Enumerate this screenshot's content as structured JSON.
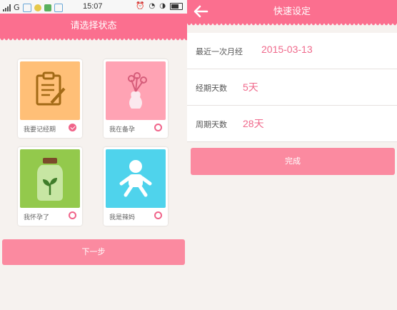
{
  "status": {
    "carrier": "G",
    "time": "15:07"
  },
  "left": {
    "title": "请选择状态",
    "options": [
      {
        "label": "我要记经期",
        "icon": "notepad-pencil-icon",
        "color": "#ffbf77",
        "checked": true
      },
      {
        "label": "我在备孕",
        "icon": "flower-vase-icon",
        "color": "#ffa3b4",
        "checked": false
      },
      {
        "label": "我怀孕了",
        "icon": "sprout-jar-icon",
        "color": "#93c94c",
        "checked": false
      },
      {
        "label": "我是辣妈",
        "icon": "baby-icon",
        "color": "#4fd3ec",
        "checked": false
      }
    ],
    "next_label": "下一步"
  },
  "right": {
    "title": "快速设定",
    "fields": [
      {
        "label": "最近一次月经",
        "value": "2015-03-13"
      },
      {
        "label": "经期天数",
        "value": "5天"
      },
      {
        "label": "周期天数",
        "value": "28天"
      }
    ],
    "done_label": "完成"
  },
  "colors": {
    "accent": "#fb6f8f",
    "button": "#fb8aa0",
    "check": "#f0648a"
  }
}
